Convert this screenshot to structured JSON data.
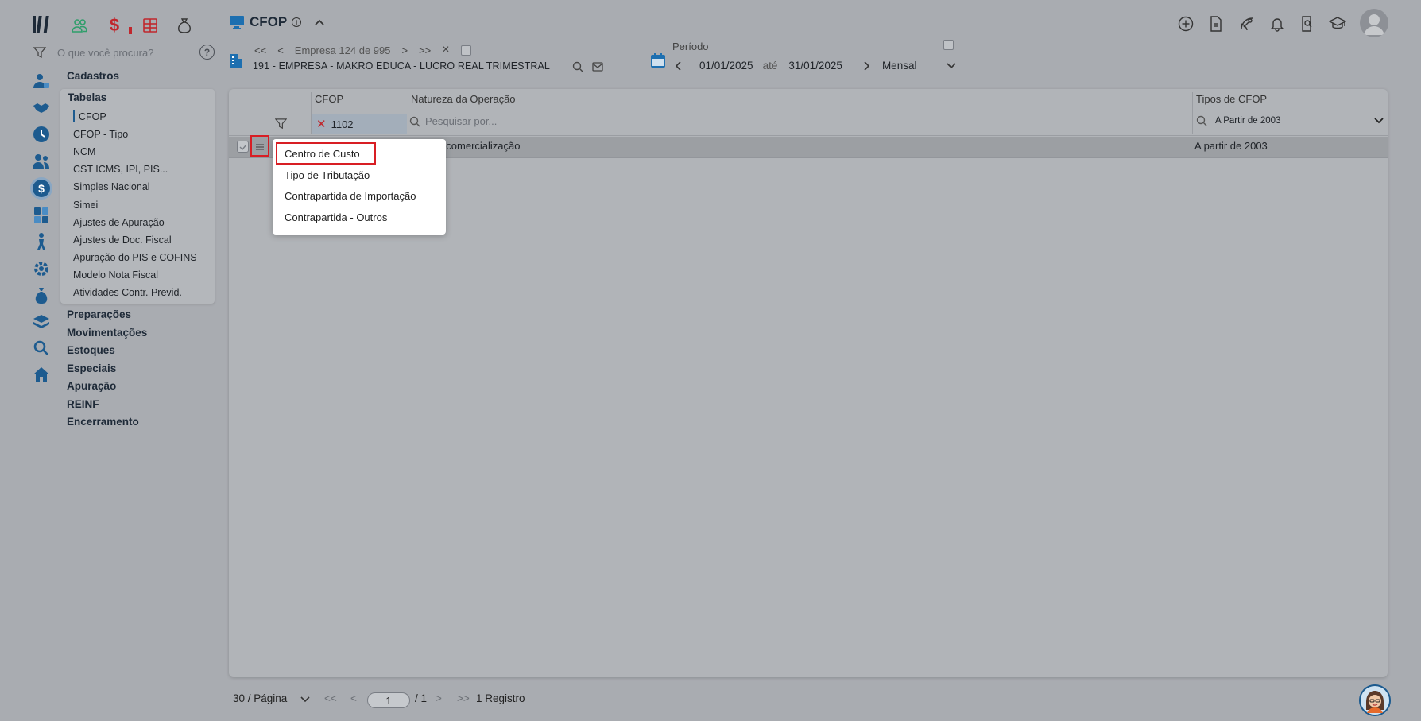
{
  "header": {
    "page_title": "CFOP",
    "info_glyph": "i"
  },
  "search": {
    "placeholder": "O que você procura?",
    "help_glyph": "?"
  },
  "company": {
    "nav_first": "<<",
    "nav_prev": "<",
    "counter": "Empresa 124 de 995",
    "nav_next": ">",
    "nav_last": ">>",
    "nav_close": "×",
    "name": "191 - EMPRESA - MAKRO EDUCA - LUCRO REAL TRIMESTRAL"
  },
  "periodo": {
    "label": "Período",
    "start": "01/01/2025",
    "sep": "até",
    "end": "31/01/2025",
    "mode": "Mensal"
  },
  "sidebar": {
    "sections": [
      "Cadastros",
      "Tabelas",
      "Preparações",
      "Movimentações",
      "Estoques",
      "Especiais",
      "Apuração",
      "REINF",
      "Encerramento"
    ],
    "tabelas_items": [
      "CFOP",
      "CFOP - Tipo",
      "NCM",
      "CST ICMS, IPI, PIS...",
      "Simples Nacional",
      "Simei",
      "Ajustes de Apuração",
      "Ajustes de Doc. Fiscal",
      "Apuração do PIS e COFINS",
      "Modelo Nota Fiscal",
      "Atividades Contr. Previd."
    ]
  },
  "grid": {
    "columns": [
      "CFOP",
      "Natureza da Operação",
      "Tipos de CFOP"
    ],
    "filter_cfop": "1102",
    "filter_search_placeholder": "Pesquisar por...",
    "filter_tipo": "A Partir de 2003",
    "rows": [
      {
        "natureza_visible": "a p/ comercialização",
        "tipo": "A partir de 2003"
      }
    ]
  },
  "context_menu": {
    "items": [
      "Centro de Custo",
      "Tipo de Tributação",
      "Contrapartida de Importação",
      "Contrapartida - Outros"
    ]
  },
  "pagination": {
    "per_page": "30 / Página",
    "first": "<<",
    "prev": "<",
    "current_page": "1",
    "total_pages": "/ 1",
    "next": ">",
    "last": ">>",
    "records": "1 Registro"
  },
  "colors": {
    "accent": "#1d5b8f",
    "highlight_red": "#d81e24",
    "green_icon": "#2e9e6a",
    "red_icon": "#c0272d"
  },
  "icons": {
    "top_left": [
      "app-logo-icon",
      "people-group-icon",
      "dollar-icon",
      "spreadsheet-icon",
      "money-bag-icon"
    ],
    "top_right": [
      "add-circle-icon",
      "document-icon",
      "satellite-icon",
      "bell-icon",
      "receipt-search-icon",
      "graduation-cap-icon",
      "user-avatar-icon"
    ],
    "rail": [
      "user-card-icon",
      "handshake-icon",
      "clock-icon",
      "users-icon",
      "dollar-circle-icon",
      "calculator-icon",
      "person-walk-icon",
      "gear-network-icon",
      "money-bag-icon",
      "layers-icon",
      "search-icon",
      "home-icon"
    ]
  }
}
